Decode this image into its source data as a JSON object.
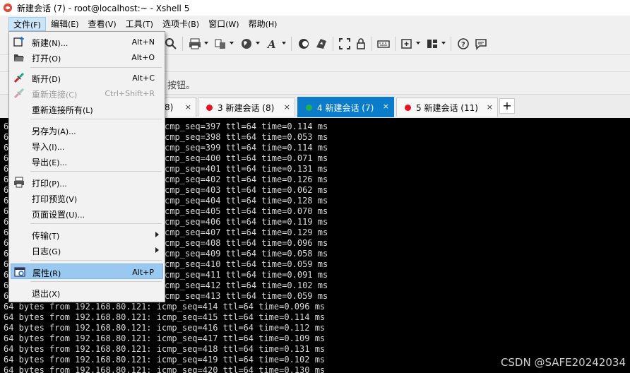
{
  "window": {
    "title": "新建会话 (7) - root@localhost:~ - Xshell 5"
  },
  "menubar": [
    {
      "label": "文件",
      "key": "(F)"
    },
    {
      "label": "编辑",
      "key": "(E)"
    },
    {
      "label": "查看",
      "key": "(V)"
    },
    {
      "label": "工具",
      "key": "(T)"
    },
    {
      "label": "选项卡",
      "key": "(B)"
    },
    {
      "label": "窗口",
      "key": "(W)"
    },
    {
      "label": "帮助",
      "key": "(H)"
    }
  ],
  "notice": {
    "text": "按钮。"
  },
  "tabs": [
    {
      "label": "8)",
      "close": "×",
      "dot": ""
    },
    {
      "label": "3 新建会话 (8)",
      "close": "×",
      "dot": "#e81123"
    },
    {
      "label": "4 新建会话 (7)",
      "close": "×",
      "dot": "#22b14c"
    },
    {
      "label": "5 新建会话 (11)",
      "close": "×",
      "dot": "#e81123"
    }
  ],
  "tab_add": "+",
  "file_menu": {
    "items": [
      {
        "label": "新建",
        "key": "(N)...",
        "shortcut": "Alt+N",
        "icon": "new-session-icon"
      },
      {
        "label": "打开",
        "key": "(O)",
        "shortcut": "Alt+O",
        "icon": "open-folder-icon"
      },
      {
        "label": "断开",
        "key": "(D)",
        "shortcut": "Alt+C",
        "icon": "disconnect-icon"
      },
      {
        "label": "重新连接",
        "key": "(C)",
        "shortcut": "Ctrl+Shift+R",
        "icon": "reconnect-icon"
      },
      {
        "label": "重新连接所有",
        "key": "(L)",
        "shortcut": "",
        "icon": ""
      },
      {
        "label": "另存为",
        "key": "(A)...",
        "shortcut": "",
        "icon": ""
      },
      {
        "label": "导入",
        "key": "(I)...",
        "shortcut": "",
        "icon": ""
      },
      {
        "label": "导出",
        "key": "(E)...",
        "shortcut": "",
        "icon": ""
      },
      {
        "label": "打印",
        "key": "(P)...",
        "shortcut": "",
        "icon": "printer-icon"
      },
      {
        "label": "打印预览",
        "key": "(V)",
        "shortcut": "",
        "icon": ""
      },
      {
        "label": "页面设置",
        "key": "(U)...",
        "shortcut": "",
        "icon": ""
      },
      {
        "label": "传输",
        "key": "(T)",
        "shortcut": "",
        "icon": ""
      },
      {
        "label": "日志",
        "key": "(G)",
        "shortcut": "",
        "icon": ""
      },
      {
        "label": "属性",
        "key": "(R)",
        "shortcut": "Alt+P",
        "icon": "properties-icon"
      },
      {
        "label": "退出",
        "key": "(X)",
        "shortcut": "",
        "icon": ""
      }
    ]
  },
  "terminal": {
    "partial_lines": [
      {
        "prefix": "64",
        "rest": "cmp_seq=397 ttl=64 time=0.114 ms"
      },
      {
        "prefix": "64",
        "rest": "cmp_seq=398 ttl=64 time=0.053 ms"
      },
      {
        "prefix": "64",
        "rest": "cmp_seq=399 ttl=64 time=0.114 ms"
      },
      {
        "prefix": "64",
        "rest": "cmp_seq=400 ttl=64 time=0.071 ms"
      },
      {
        "prefix": "64",
        "rest": "cmp_seq=401 ttl=64 time=0.131 ms"
      },
      {
        "prefix": "64",
        "rest": "cmp_seq=402 ttl=64 time=0.126 ms"
      },
      {
        "prefix": "64",
        "rest": "cmp_seq=403 ttl=64 time=0.062 ms"
      },
      {
        "prefix": "64",
        "rest": "cmp_seq=404 ttl=64 time=0.128 ms"
      },
      {
        "prefix": "64",
        "rest": "cmp_seq=405 ttl=64 time=0.070 ms"
      },
      {
        "prefix": "64",
        "rest": "cmp_seq=406 ttl=64 time=0.119 ms"
      },
      {
        "prefix": "64",
        "rest": "cmp_seq=407 ttl=64 time=0.129 ms"
      },
      {
        "prefix": "64",
        "rest": "cmp_seq=408 ttl=64 time=0.096 ms"
      },
      {
        "prefix": "64",
        "rest": "cmp_seq=409 ttl=64 time=0.058 ms"
      },
      {
        "prefix": "64",
        "rest": "cmp_seq=410 ttl=64 time=0.059 ms"
      },
      {
        "prefix": "64",
        "rest": "cmp_seq=411 ttl=64 time=0.091 ms"
      },
      {
        "prefix": "64",
        "rest": "cmp_seq=412 ttl=64 time=0.102 ms"
      },
      {
        "prefix": "64",
        "rest": "cmp_seq=413 ttl=64 time=0.059 ms"
      }
    ],
    "full_lines": [
      "64 bytes from 192.168.80.121: icmp_seq=414 ttl=64 time=0.096 ms",
      "64 bytes from 192.168.80.121: icmp_seq=415 ttl=64 time=0.114 ms",
      "64 bytes from 192.168.80.121: icmp_seq=416 ttl=64 time=0.112 ms",
      "64 bytes from 192.168.80.121: icmp_seq=417 ttl=64 time=0.109 ms",
      "64 bytes from 192.168.80.121: icmp_seq=418 ttl=64 time=0.131 ms",
      "64 bytes from 192.168.80.121: icmp_seq=419 ttl=64 time=0.102 ms",
      "64 bytes from 192.168.80.121: icmp_seq=420 ttl=64 time=0.130 ms"
    ]
  },
  "watermark": "CSDN @SAFE20242034",
  "colors": {
    "active_tab": "#0a7cc9",
    "menu_highlight": "#99c9f0",
    "terminal_bg": "#000000",
    "terminal_fg": "#dcdcdc"
  }
}
